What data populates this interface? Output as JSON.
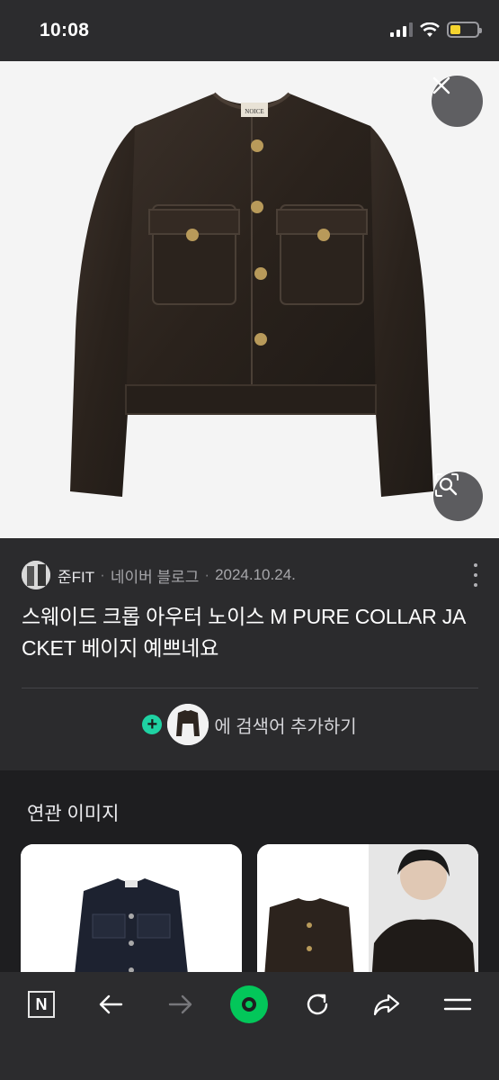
{
  "status_bar": {
    "time": "10:08"
  },
  "post": {
    "author": "준FIT",
    "platform": "네이버 블로그",
    "date": "2024.10.24.",
    "title": "스웨이드 크롭 아우터 노이스 M PURE COLLAR JACKET 베이지 예쁘네요",
    "add_keyword_text": "에 검색어 추가하기",
    "label_on_jacket": "NOICE"
  },
  "related": {
    "title": "연관 이미지"
  },
  "icons": {
    "close": "close-icon",
    "lens": "image-search-icon",
    "more": "more-vertical-icon",
    "add": "plus-icon",
    "naver": "naver-n-icon",
    "back": "arrow-left-icon",
    "forward": "arrow-right-icon",
    "home": "green-circle-icon",
    "refresh": "refresh-icon",
    "share": "share-icon",
    "menu": "menu-icon"
  },
  "colors": {
    "accent_green": "#03c75a",
    "plus_teal": "#1fd2a3",
    "battery_yellow": "#f5d42e",
    "jacket_brown": "#2f2620"
  },
  "toolbar": {
    "naver_letter": "N"
  }
}
